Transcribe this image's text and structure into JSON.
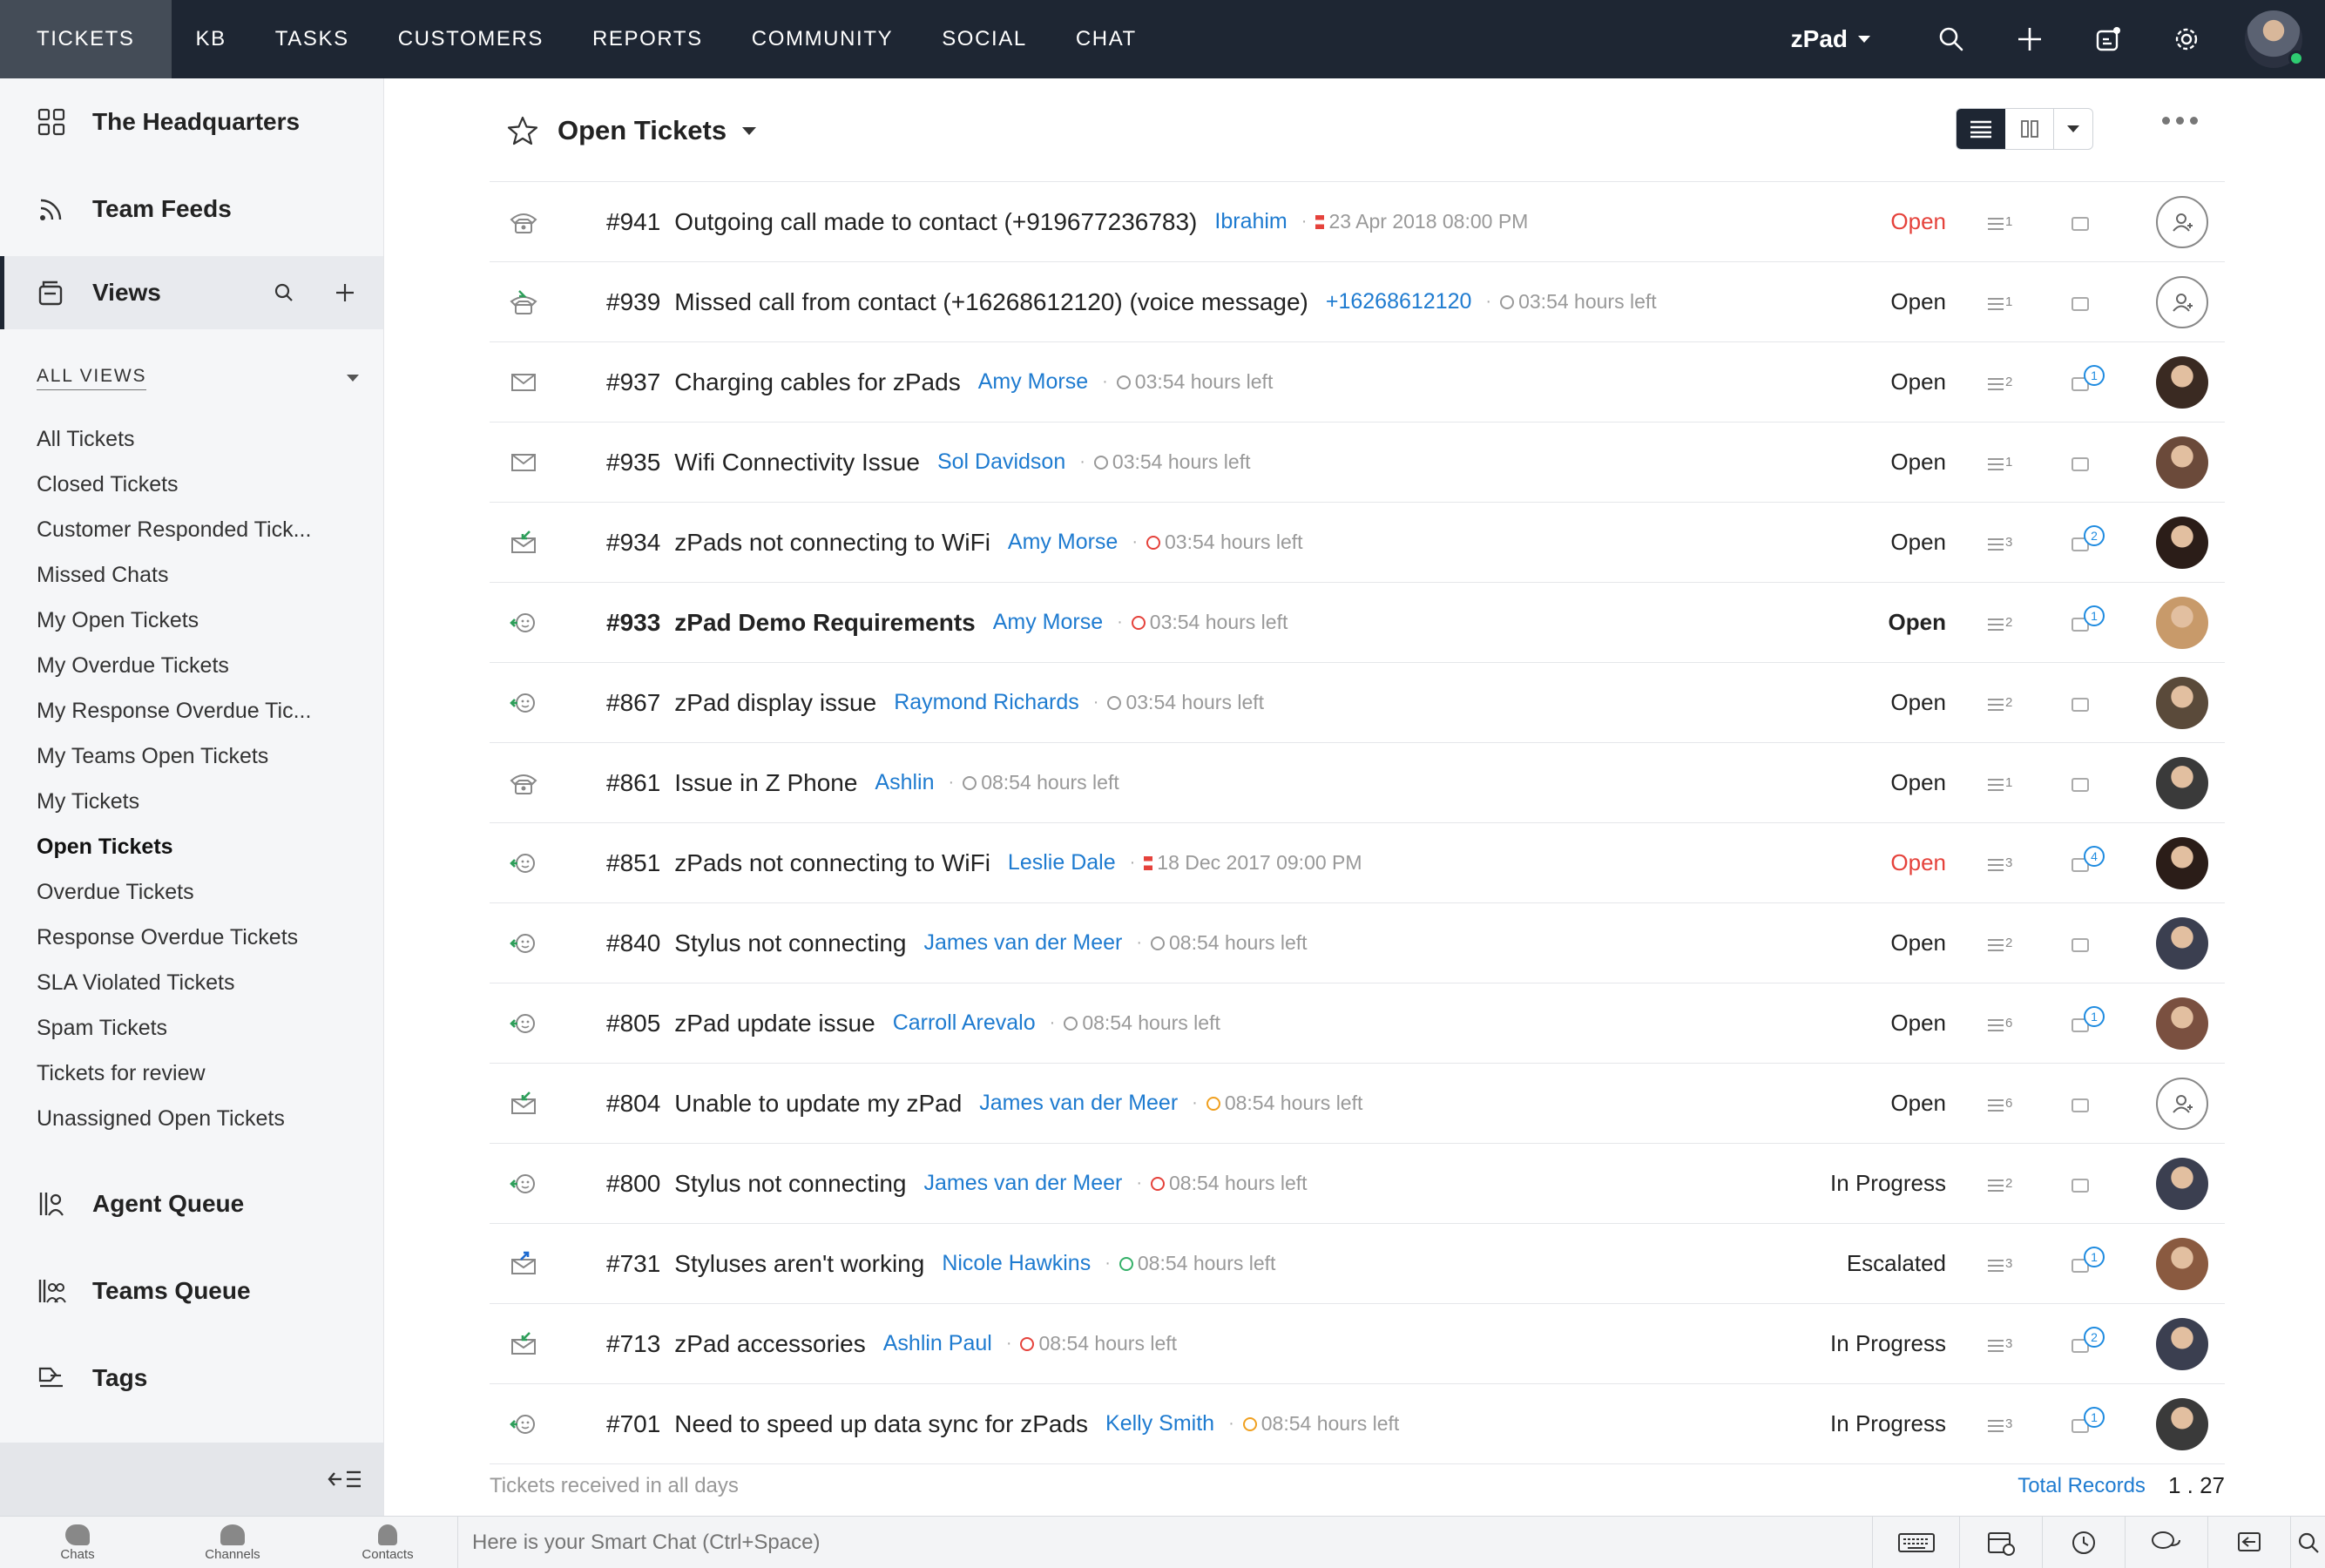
{
  "nav": {
    "items": [
      "TICKETS",
      "KB",
      "TASKS",
      "CUSTOMERS",
      "REPORTS",
      "COMMUNITY",
      "SOCIAL",
      "CHAT"
    ],
    "active": "TICKETS",
    "brand": "zPad",
    "icons": [
      "search-icon",
      "plus-icon",
      "compose-icon",
      "settings-icon"
    ]
  },
  "sidebar": {
    "top_items": [
      {
        "label": "The Headquarters",
        "icon": "grid-icon"
      },
      {
        "label": "Team Feeds",
        "icon": "feed-icon"
      }
    ],
    "views_label": "Views",
    "all_views_label": "ALL VIEWS",
    "views": [
      "All Tickets",
      "Closed Tickets",
      "Customer Responded Tick...",
      "Missed Chats",
      "My Open Tickets",
      "My Overdue Tickets",
      "My Response Overdue Tic...",
      "My Teams Open Tickets",
      "My Tickets",
      "Open Tickets",
      "Overdue Tickets",
      "Response Overdue Tickets",
      "SLA Violated Tickets",
      "Spam Tickets",
      "Tickets for review",
      "Unassigned Open Tickets"
    ],
    "active_view": "Open Tickets",
    "bottom_items": [
      {
        "label": "Agent Queue",
        "icon": "agent-queue-icon"
      },
      {
        "label": "Teams Queue",
        "icon": "teams-queue-icon"
      },
      {
        "label": "Tags",
        "icon": "tags-icon"
      }
    ]
  },
  "main": {
    "title": "Open Tickets",
    "footer_note": "Tickets received in all days",
    "total_label": "Total Records",
    "total_value": "1 . 27"
  },
  "tickets": [
    {
      "id": "#941",
      "subject": "Outgoing call made to contact (+919677236783)",
      "contact": "Ibrahim",
      "due": "23 Apr 2018 08:00 PM",
      "due_type": "overdue",
      "status": "Open",
      "status_color": "#e5423b",
      "threads": "1",
      "comments": "",
      "channel": "phone-icon",
      "owner": "unassigned",
      "bold": false
    },
    {
      "id": "#939",
      "subject": "Missed call from contact (+16268612120) (voice message)",
      "contact": "+16268612120",
      "due": "03:54 hours left",
      "due_type": "grey",
      "status": "Open",
      "status_color": "#222222",
      "threads": "1",
      "comments": "",
      "channel": "phone-in-icon",
      "owner": "unassigned",
      "bold": false
    },
    {
      "id": "#937",
      "subject": "Charging cables for zPads",
      "contact": "Amy Morse",
      "due": "03:54 hours left",
      "due_type": "grey",
      "status": "Open",
      "status_color": "#222222",
      "threads": "2",
      "comments": "1",
      "channel": "email-icon",
      "owner": "#3a2a22",
      "bold": false
    },
    {
      "id": "#935",
      "subject": "Wifi Connectivity Issue",
      "contact": "Sol Davidson",
      "due": "03:54 hours left",
      "due_type": "grey",
      "status": "Open",
      "status_color": "#222222",
      "threads": "1",
      "comments": "",
      "channel": "email-icon",
      "owner": "#6b4a3a",
      "bold": false
    },
    {
      "id": "#934",
      "subject": "zPads not connecting to WiFi",
      "contact": "Amy Morse",
      "due": "03:54 hours left",
      "due_type": "red",
      "status": "Open",
      "status_color": "#222222",
      "threads": "3",
      "comments": "2",
      "channel": "email-in-icon",
      "owner": "#2b1d18",
      "bold": false
    },
    {
      "id": "#933",
      "subject": "zPad Demo Requirements",
      "contact": "Amy Morse",
      "due": "03:54 hours left",
      "due_type": "red",
      "status": "Open",
      "status_color": "#222222",
      "threads": "2",
      "comments": "1",
      "channel": "chat-icon",
      "owner": "#c89a6a",
      "bold": true
    },
    {
      "id": "#867",
      "subject": "zPad display issue",
      "contact": "Raymond Richards",
      "due": "03:54 hours left",
      "due_type": "grey",
      "status": "Open",
      "status_color": "#222222",
      "threads": "2",
      "comments": "",
      "channel": "chat-icon",
      "owner": "#5a4a3a",
      "bold": false
    },
    {
      "id": "#861",
      "subject": "Issue in Z Phone",
      "contact": "Ashlin",
      "due": "08:54 hours left",
      "due_type": "grey",
      "status": "Open",
      "status_color": "#222222",
      "threads": "1",
      "comments": "",
      "channel": "phone-icon",
      "owner": "#3a3a3a",
      "bold": false
    },
    {
      "id": "#851",
      "subject": "zPads not connecting to WiFi",
      "contact": "Leslie Dale",
      "due": "18 Dec 2017 09:00 PM",
      "due_type": "overdue",
      "status": "Open",
      "status_color": "#e5423b",
      "threads": "3",
      "comments": "4",
      "channel": "chat-icon",
      "owner": "#2b1d18",
      "bold": false
    },
    {
      "id": "#840",
      "subject": "Stylus not connecting",
      "contact": "James van der Meer",
      "due": "08:54 hours left",
      "due_type": "grey",
      "status": "Open",
      "status_color": "#222222",
      "threads": "2",
      "comments": "",
      "channel": "chat-icon",
      "owner": "#3b3f50",
      "bold": false
    },
    {
      "id": "#805",
      "subject": "zPad update issue",
      "contact": "Carroll Arevalo",
      "due": "08:54 hours left",
      "due_type": "grey",
      "status": "Open",
      "status_color": "#222222",
      "threads": "6",
      "comments": "1",
      "channel": "chat-icon",
      "owner": "#7a5040",
      "bold": false
    },
    {
      "id": "#804",
      "subject": "Unable to update my zPad",
      "contact": "James van der Meer",
      "due": "08:54 hours left",
      "due_type": "orange",
      "status": "Open",
      "status_color": "#222222",
      "threads": "6",
      "comments": "",
      "channel": "email-in-icon",
      "owner": "unassigned",
      "bold": false
    },
    {
      "id": "#800",
      "subject": "Stylus not connecting",
      "contact": "James van der Meer",
      "due": "08:54 hours left",
      "due_type": "red",
      "status": "In Progress",
      "status_color": "#222222",
      "threads": "2",
      "comments": "",
      "channel": "chat-icon",
      "owner": "#3b3f50",
      "bold": false
    },
    {
      "id": "#731",
      "subject": "Styluses aren't working",
      "contact": "Nicole Hawkins",
      "due": "08:54 hours left",
      "due_type": "green",
      "status": "Escalated",
      "status_color": "#222222",
      "threads": "3",
      "comments": "1",
      "channel": "email-out-icon",
      "owner": "#8a5a40",
      "bold": false
    },
    {
      "id": "#713",
      "subject": "zPad accessories",
      "contact": "Ashlin Paul",
      "due": "08:54 hours left",
      "due_type": "red",
      "status": "In Progress",
      "status_color": "#222222",
      "threads": "3",
      "comments": "2",
      "channel": "email-in-icon",
      "owner": "#3b3f50",
      "bold": false
    },
    {
      "id": "#701",
      "subject": "Need to speed up data sync for zPads",
      "contact": "Kelly Smith",
      "due": "08:54 hours left",
      "due_type": "orange",
      "status": "In Progress",
      "status_color": "#222222",
      "threads": "3",
      "comments": "1",
      "channel": "chat-icon",
      "owner": "#3a3a3a",
      "bold": false
    }
  ],
  "bottombar": {
    "tabs": [
      "Chats",
      "Channels",
      "Contacts"
    ],
    "smartchat_placeholder": "Here is your Smart Chat (Ctrl+Space)",
    "right_icons": [
      "keyboard-icon",
      "calendar-icon",
      "clock-icon",
      "chat-bubbles-icon",
      "reply-icon",
      "search-icon"
    ]
  },
  "colors": {
    "topbar": "#1e2633",
    "link": "#1e7bd0",
    "overdue": "#e5423b",
    "accent": "#1e8be0"
  }
}
